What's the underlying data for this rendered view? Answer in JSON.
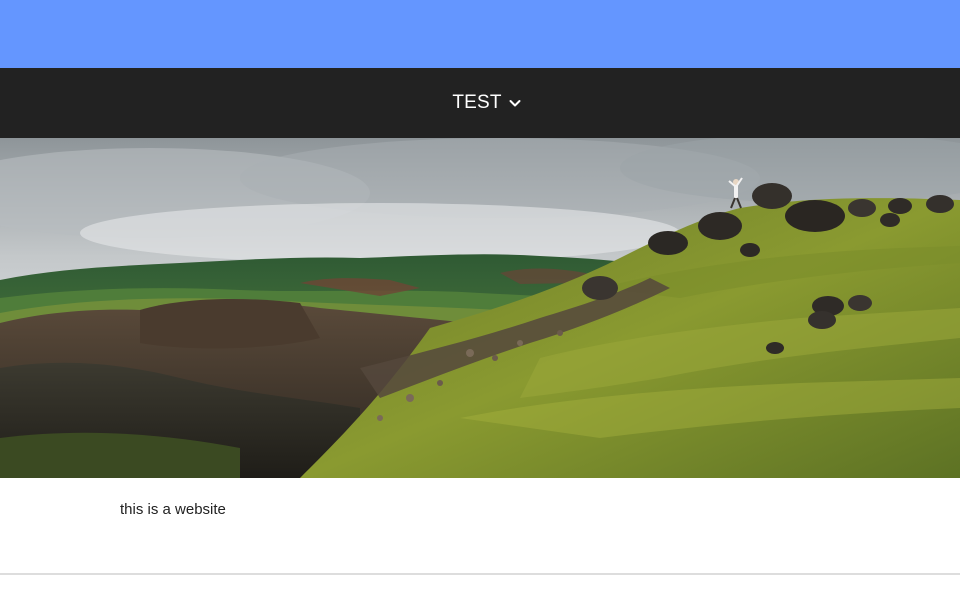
{
  "colors": {
    "topbar_bg": "#6496ff",
    "navbar_bg": "#222222",
    "nav_text": "#ffffff",
    "body_text": "#222222",
    "footer_line": "#dddddd"
  },
  "nav": {
    "items": [
      {
        "label": "TEST",
        "icon": "chevron-down-icon"
      }
    ]
  },
  "hero": {
    "icon": "landscape-image"
  },
  "content": {
    "text": "this is a website"
  }
}
